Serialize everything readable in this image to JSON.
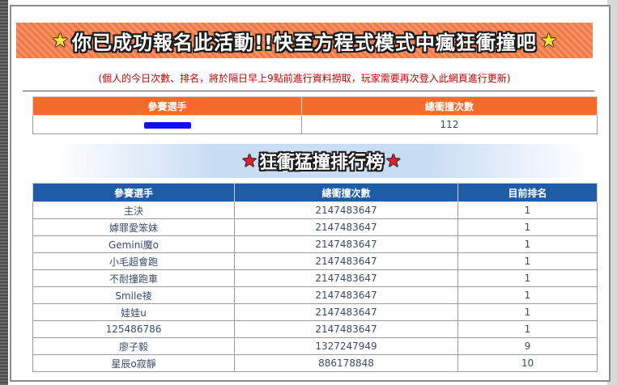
{
  "banner": {
    "title": "你已成功報名此活動!!快至方程式模式中瘋狂衝撞吧",
    "star_left": "★",
    "star_right": "★"
  },
  "notice": "(個人的今日次數、排名，將於隔日早上9點前進行資料撈取，玩家需要再次登入此網頁進行更新)",
  "self_table": {
    "headers": [
      "參賽選手",
      "總衝撞次數"
    ],
    "player": "",
    "count": "112"
  },
  "ranking": {
    "title": "狂衝猛撞排行榜",
    "star": "★",
    "headers": [
      "參賽選手",
      "總衝撞次數",
      "目前排名"
    ],
    "rows": [
      {
        "player": "主決",
        "count": "2147483647",
        "rank": "1"
      },
      {
        "player": "嫭罪愛笨妹",
        "count": "2147483647",
        "rank": "1"
      },
      {
        "player": "Gemini魔o",
        "count": "2147483647",
        "rank": "1"
      },
      {
        "player": "小毛超會跑",
        "count": "2147483647",
        "rank": "1"
      },
      {
        "player": "不耐撞跑車",
        "count": "2147483647",
        "rank": "1"
      },
      {
        "player": "Smile祾",
        "count": "2147483647",
        "rank": "1"
      },
      {
        "player": "娃娃u",
        "count": "2147483647",
        "rank": "1"
      },
      {
        "player": "125486786",
        "count": "2147483647",
        "rank": "1"
      },
      {
        "player": "廖子毅",
        "count": "1327247949",
        "rank": "9"
      },
      {
        "player": "星辰o寂靜",
        "count": "886178848",
        "rank": "10"
      }
    ]
  },
  "colors": {
    "banner_orange": "#f07844",
    "header_orange": "#f46b2a",
    "header_blue": "#1f5ca8",
    "notice_red": "#c00000",
    "cell_text": "#3a4a6a"
  }
}
